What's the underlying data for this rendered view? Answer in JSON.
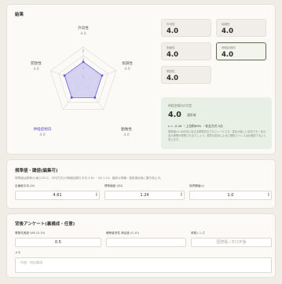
{
  "results": {
    "title": "結果",
    "radar": {
      "ticks": [
        "8",
        "6",
        "4",
        "2"
      ],
      "axes": [
        {
          "name": "外向性",
          "value": "4.0",
          "score": 4.0
        },
        {
          "name": "協調性",
          "value": "4.0",
          "score": 4.0
        },
        {
          "name": "勤勉性",
          "value": "4.0",
          "score": 4.0
        },
        {
          "name": "神経症傾向",
          "value": "4.0",
          "score": 4.0,
          "active": true
        },
        {
          "name": "開放性",
          "value": "4.0",
          "score": 4.0
        }
      ],
      "max": 7,
      "colors": {
        "fill": "#cfcaf0",
        "stroke": "#6a5fd0",
        "grid": "#dcdad2",
        "active_label": "#5a4fcf"
      }
    },
    "tiles": [
      {
        "label": "外向性",
        "value": "4.0"
      },
      {
        "label": "協調性",
        "value": "4.0"
      },
      {
        "label": "勤勉性",
        "value": "4.0"
      },
      {
        "label": "神経症傾向",
        "value": "4.0",
        "selected": true
      },
      {
        "label": "開放性",
        "value": "4.0"
      }
    ],
    "evaluation": {
      "title": "神経症傾向の判定",
      "score": "4.0",
      "tag": "通常域",
      "stats": "z = -0.49 ・上位約69% ・非全方式 0点",
      "note": "規準値±1.0SD内に収まる標準的なプロフィールです。変化が激しい状況でも一定の自己管理が発揮されるでしょう。環境の変化による心理的ストレスは比較的少ないと言えます。"
    }
  },
  "norms": {
    "title": "規準値・閾値(編集可)",
    "desc": "規準値は原典(小塩ら2012、平均方式)の神経症傾向 平均 4.61 ・SD 1.24。臨床の準備・施設適合版に置き換え可。",
    "fields": [
      {
        "label": "自偏差平均 (M)",
        "value": "4.61"
      },
      {
        "label": "標準偏差 (SD)",
        "value": "1.24"
      },
      {
        "label": "境界閾値(z)",
        "value": "1.0"
      }
    ]
  },
  "survey": {
    "title": "背後アンケート(裏構成・任意)",
    "fields": [
      {
        "label": "業務充実度 VAS (0-10)",
        "value": "0.5",
        "placeholder": ""
      },
      {
        "label": "睡眠者的性 満足度 (0-10)",
        "value": "",
        "placeholder": ""
      },
      {
        "label": "参照レンズ",
        "value": "",
        "placeholder": "国際版 / ECOF版"
      }
    ],
    "memo_label": "メモ",
    "memo_placeholder": "所感・特記事項"
  }
}
